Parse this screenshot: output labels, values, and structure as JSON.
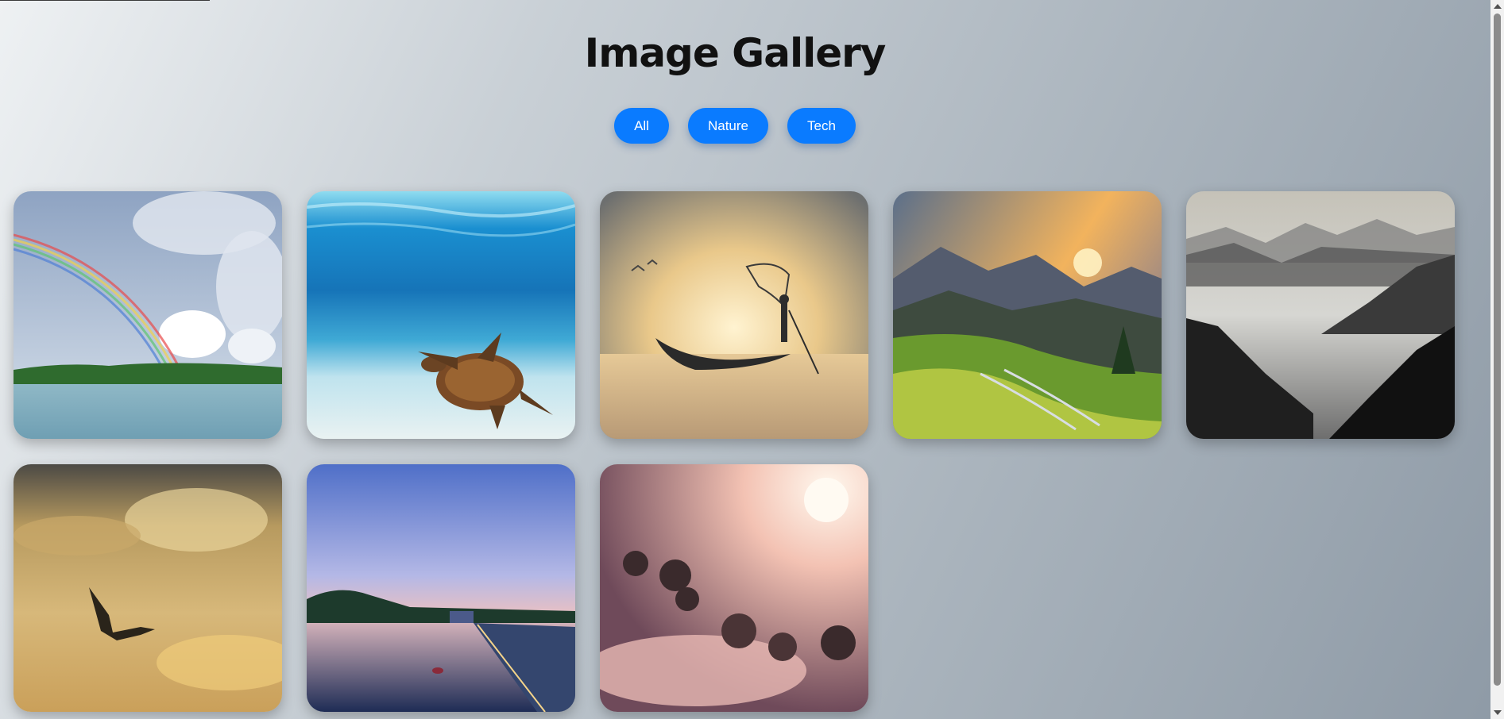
{
  "page": {
    "title": "Image Gallery"
  },
  "filters": [
    {
      "label": "All"
    },
    {
      "label": "Nature"
    },
    {
      "label": "Tech"
    }
  ],
  "gallery": {
    "images": [
      {
        "subject": "rainbow-over-lake"
      },
      {
        "subject": "sea-turtle-underwater"
      },
      {
        "subject": "fisherman-on-boat-at-sunrise"
      },
      {
        "subject": "rice-terraces-at-sunset"
      },
      {
        "subject": "misty-mountain-valley"
      },
      {
        "subject": "bird-flying-in-golden-clouds"
      },
      {
        "subject": "lake-pier-at-dusk"
      },
      {
        "subject": "foggy-forest-sunrise"
      }
    ]
  },
  "colors": {
    "accent": "#0a7bff",
    "title": "#111111"
  }
}
